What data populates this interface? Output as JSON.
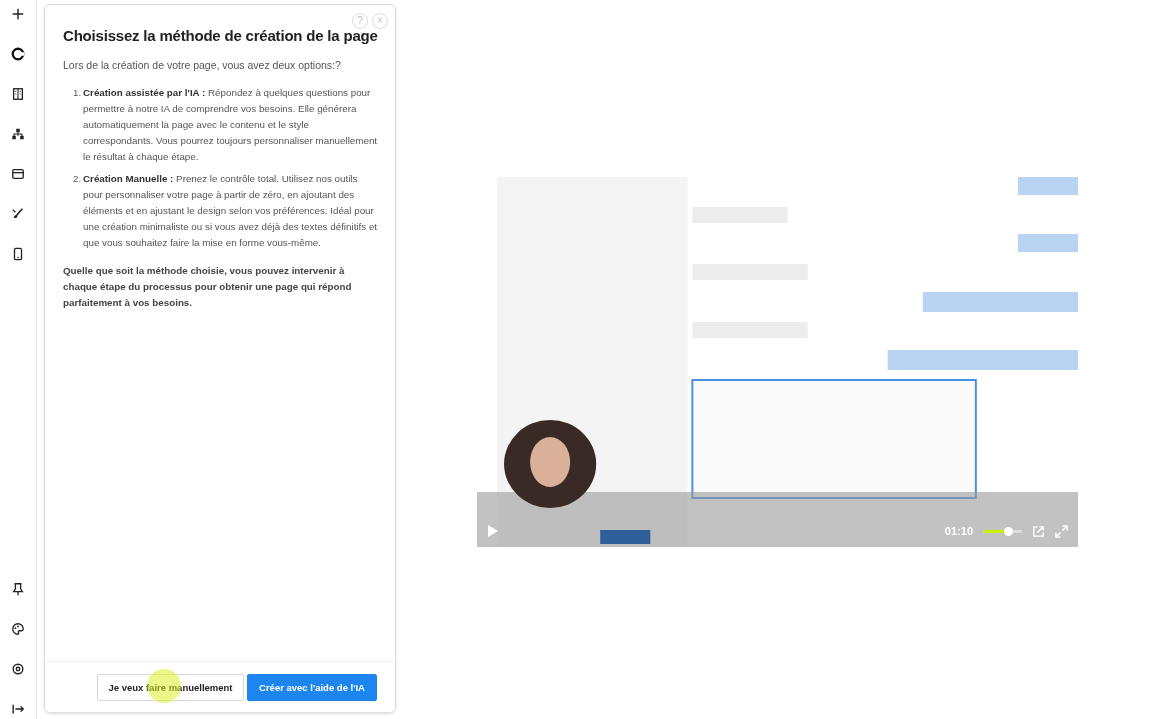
{
  "dialog": {
    "title": "Choisissez la méthode de création de la page",
    "intro": "Lors de la création de votre page, vous avez deux options:?",
    "options": [
      {
        "number": "1.",
        "text": "**Création assistée par l'IA :** Répondez à quelques questions pour permettre à notre IA de comprendre vos besoins. Elle générera automatiquement la page avec le contenu et le style correspondants. Vous pourrez toujours personnaliser manuellement le résultat à chaque étape."
      },
      {
        "number": "2.",
        "text": "**Création Manuelle :** Prenez le contrôle total. Utilisez nos outils pour personnaliser votre page à partir de zéro, en ajoutant des éléments et en ajustant le design selon vos préférences. Idéal pour une création minimaliste ou si vous avez déjà des textes définitifs et que vous souhaitez faire la mise en forme vous-même."
      }
    ],
    "conclusion": "Quelle que soit la méthode choisie, vous pouvez intervenir à chaque étape du processus pour obtenir une page qui répond parfaitement à vos besoins.",
    "help_button": "?",
    "close_button": "×",
    "buttons": [
      {
        "label": "Je veux faire manuellement",
        "kind": "secondary"
      },
      {
        "label": "Créer avec l'aide de l'IA",
        "kind": "primary"
      }
    ]
  },
  "video": {
    "kind": "picture",
    "time": "01:10",
    "volume": {
      "level": 0.65
    }
  }
}
